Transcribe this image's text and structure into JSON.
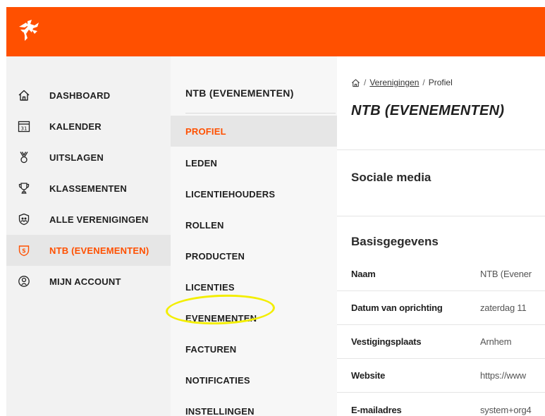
{
  "colors": {
    "brand": "#ff5000",
    "highlight": "#f3ee00"
  },
  "sidebar": {
    "items": [
      {
        "label": "DASHBOARD",
        "icon": "home-icon"
      },
      {
        "label": "KALENDER",
        "icon": "calendar-icon",
        "icon_text": "31"
      },
      {
        "label": "UITSLAGEN",
        "icon": "medal-icon"
      },
      {
        "label": "KLASSEMENTEN",
        "icon": "trophy-icon"
      },
      {
        "label": "ALLE VERENIGINGEN",
        "icon": "group-shield-icon"
      },
      {
        "label": "NTB (EVENEMENTEN)",
        "icon": "club-shield-icon",
        "active": true
      },
      {
        "label": "MIJN ACCOUNT",
        "icon": "account-icon"
      }
    ]
  },
  "subnav": {
    "title": "NTB (EVENEMENTEN)",
    "items": [
      {
        "label": "PROFIEL",
        "active": true
      },
      {
        "label": "LEDEN"
      },
      {
        "label": "LICENTIEHOUDERS"
      },
      {
        "label": "ROLLEN"
      },
      {
        "label": "PRODUCTEN"
      },
      {
        "label": "LICENTIES"
      },
      {
        "label": "EVENEMENTEN",
        "highlighted": true
      },
      {
        "label": "FACTUREN"
      },
      {
        "label": "NOTIFICATIES"
      },
      {
        "label": "INSTELLINGEN"
      }
    ]
  },
  "main": {
    "breadcrumb": {
      "home_icon": "home-icon",
      "sep1": "/",
      "link": "Verenigingen",
      "sep2": "/",
      "current": "Profiel"
    },
    "title": "NTB (EVENEMENTEN)",
    "social_title": "Sociale media",
    "basis_title": "Basisgegevens",
    "rows": [
      {
        "label": "Naam",
        "value": "NTB (Evener"
      },
      {
        "label": "Datum van oprichting",
        "value": "zaterdag 11"
      },
      {
        "label": "Vestigingsplaats",
        "value": "Arnhem"
      },
      {
        "label": "Website",
        "value": "https://www"
      },
      {
        "label": "E-mailadres",
        "value": "system+org4"
      }
    ]
  }
}
